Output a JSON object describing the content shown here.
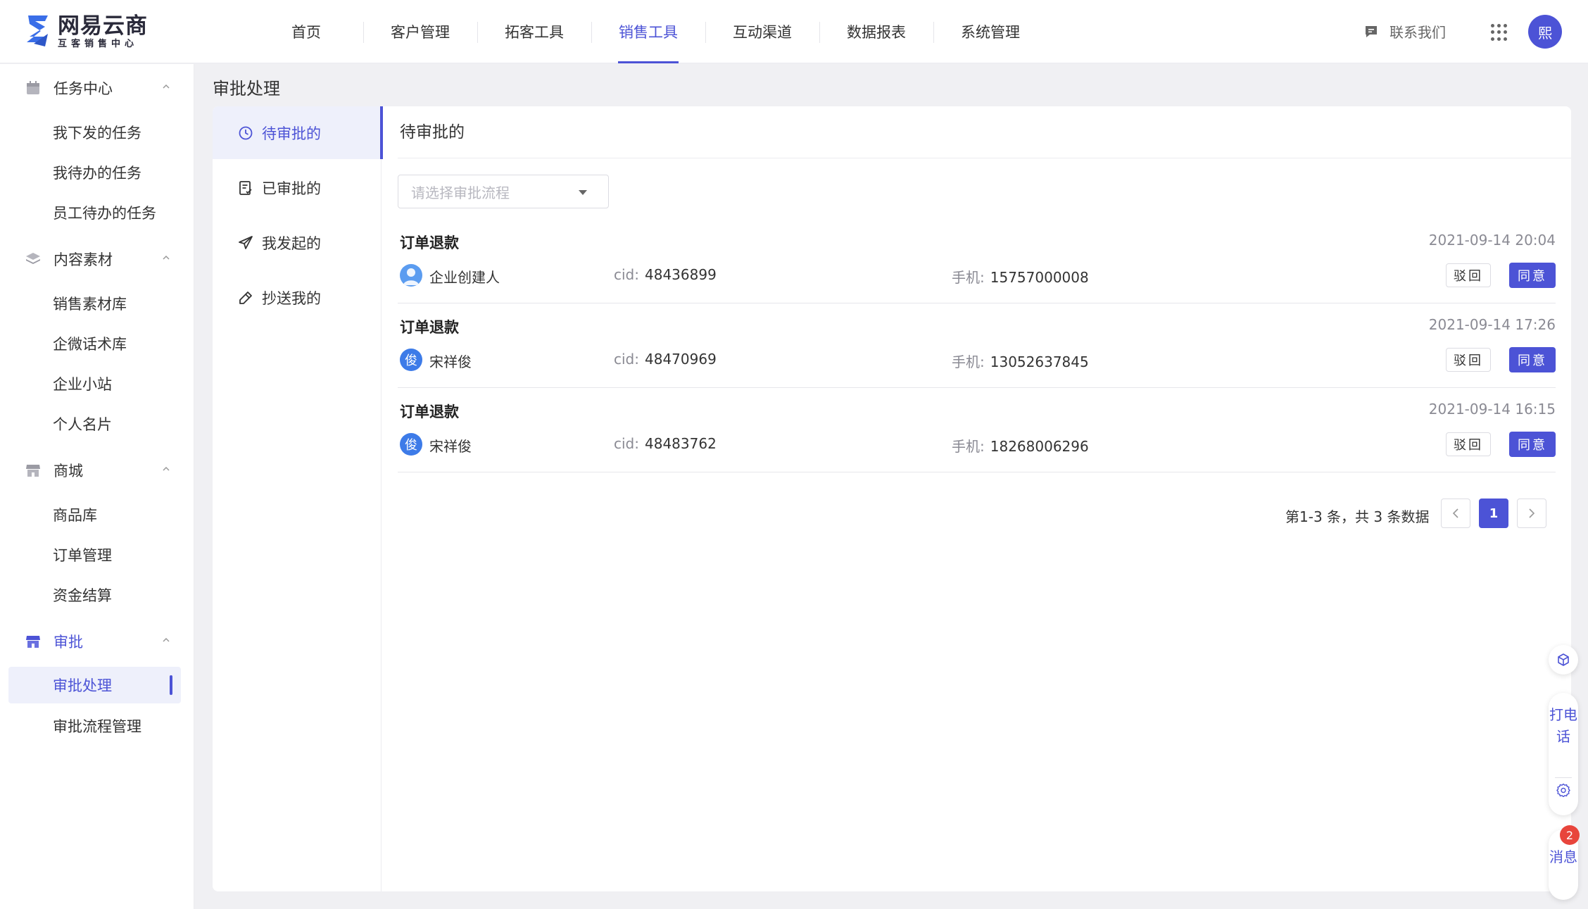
{
  "brand": {
    "title": "网易云商",
    "subtitle": "互客销售中心"
  },
  "nav": [
    "首页",
    "客户管理",
    "拓客工具",
    "销售工具",
    "互动渠道",
    "数据报表",
    "系统管理"
  ],
  "nav_active": "销售工具",
  "header": {
    "contact": "联系我们",
    "avatar_text": "熙"
  },
  "sidebar": {
    "groups": [
      {
        "label": "任务中心",
        "icon": "calendar-icon",
        "items": [
          "我下发的任务",
          "我待办的任务",
          "员工待办的任务"
        ]
      },
      {
        "label": "内容素材",
        "icon": "layers-icon",
        "items": [
          "销售素材库",
          "企微话术库",
          "企业小站",
          "个人名片"
        ]
      },
      {
        "label": "商城",
        "icon": "store-icon",
        "items": [
          "商品库",
          "订单管理",
          "资金结算"
        ]
      },
      {
        "label": "审批",
        "icon": "approval-icon",
        "items": [
          "审批处理",
          "审批流程管理"
        ]
      }
    ],
    "active_item": "审批处理"
  },
  "page_title": "审批处理",
  "subnav": [
    {
      "label": "待审批的",
      "icon": "clock-icon"
    },
    {
      "label": "已审批的",
      "icon": "checklist-icon"
    },
    {
      "label": "我发起的",
      "icon": "send-icon"
    },
    {
      "label": "抄送我的",
      "icon": "pencil-icon"
    }
  ],
  "content": {
    "title": "待审批的",
    "select_placeholder": "请选择审批流程",
    "labels": {
      "cid": "cid:",
      "phone": "手机:",
      "reject": "驳回",
      "agree": "同意"
    },
    "records": [
      {
        "title": "订单退款",
        "time": "2021-09-14 20:04",
        "name": "企业创建人",
        "avatar": "",
        "cid": "48436899",
        "phone": "15757000008"
      },
      {
        "title": "订单退款",
        "time": "2021-09-14 17:26",
        "name": "宋祥俊",
        "avatar": "俊",
        "cid": "48470969",
        "phone": "13052637845"
      },
      {
        "title": "订单退款",
        "time": "2021-09-14 16:15",
        "name": "宋祥俊",
        "avatar": "俊",
        "cid": "48483762",
        "phone": "18268006296"
      }
    ],
    "pagination": {
      "info": "第1-3 条，共 3 条数据",
      "current": "1"
    }
  },
  "floating": {
    "call": "打电话",
    "messages": "消息",
    "badge": "2"
  },
  "colors": {
    "accent": "#4c53d6",
    "badge": "#e8453c"
  }
}
